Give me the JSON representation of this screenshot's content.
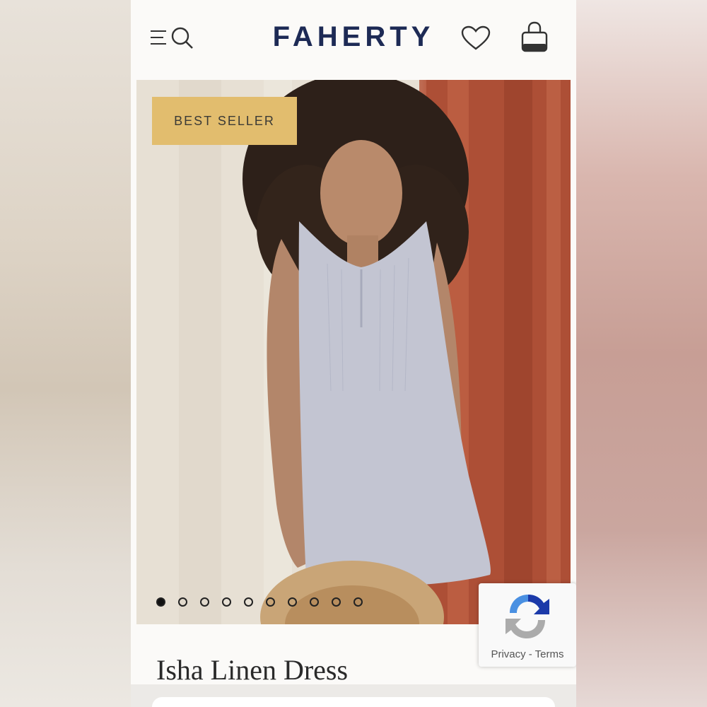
{
  "header": {
    "brand": "FAHERTY",
    "icons": [
      "menu-icon",
      "search-icon",
      "heart-icon",
      "shopping-bag-icon"
    ]
  },
  "hero": {
    "badge": "BEST SELLER",
    "carousel": {
      "total": 10,
      "active_index": 0
    }
  },
  "recaptcha": {
    "links": "Privacy - Terms"
  },
  "product": {
    "title": "Isha Linen Dress"
  },
  "colors": {
    "brand": "#1d2a55",
    "badge": "#e2bd6e"
  }
}
